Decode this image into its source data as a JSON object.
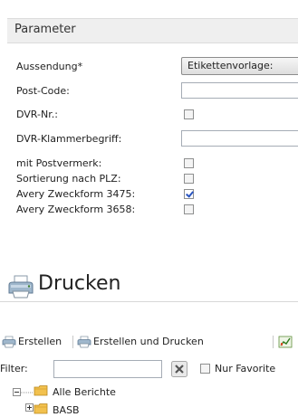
{
  "parameter": {
    "header": "Parameter",
    "fields": [
      {
        "label": "Aussendung*",
        "type": "select",
        "value": "Etikettenvorlage:"
      },
      {
        "label": "Post-Code:",
        "type": "text",
        "value": ""
      },
      {
        "label": "DVR-Nr.:",
        "type": "checkbox",
        "checked": false
      },
      {
        "label": "DVR-Klammerbegriff:",
        "type": "text",
        "value": ""
      },
      {
        "label": "mit Postvermerk:",
        "type": "checkbox",
        "checked": false
      },
      {
        "label": "Sortierung nach PLZ:",
        "type": "checkbox",
        "checked": false
      },
      {
        "label": "Avery Zweckform 3475:",
        "type": "checkbox",
        "checked": true
      },
      {
        "label": "Avery Zweckform 3658:",
        "type": "checkbox",
        "checked": false
      }
    ]
  },
  "print": {
    "title": "Drucken",
    "icon": "printer-icon"
  },
  "toolbar": {
    "create_label": "Erstellen",
    "create_print_label": "Erstellen und Drucken"
  },
  "filter": {
    "label": "Filter:",
    "value": "",
    "favorites_label": "Nur Favorite",
    "favorites_checked": false
  },
  "tree": {
    "root_label": "Alle Berichte",
    "child_label": "BASB"
  },
  "colors": {
    "checkmark": "#2a55c0",
    "folder": "#e8b32a"
  }
}
